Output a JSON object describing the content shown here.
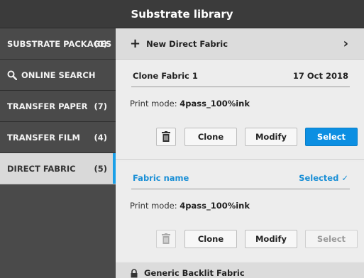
{
  "window": {
    "title": "Substrate library"
  },
  "sidebar": {
    "items": [
      {
        "label": "SUBSTRATE PACKAGES",
        "count": "(0)",
        "icon": ""
      },
      {
        "label": "ONLINE SEARCH",
        "count": "",
        "icon": "search-icon"
      },
      {
        "label": "TRANSFER PAPER",
        "count": "(7)",
        "icon": ""
      },
      {
        "label": "TRANSFER FILM",
        "count": "(4)",
        "icon": ""
      },
      {
        "label": "DIRECT FABRIC",
        "count": "(5)",
        "icon": "",
        "active": true
      }
    ]
  },
  "main": {
    "new_label": "New Direct Fabric",
    "cards": [
      {
        "name": "Clone Fabric 1",
        "date": "17 Oct 2018",
        "mode_label": "Print mode:",
        "mode_value": "4pass_100%ink",
        "clone": "Clone",
        "modify": "Modify",
        "select": "Select",
        "selected": false
      },
      {
        "name": "Fabric name",
        "date": "Selected",
        "mode_label": "Print mode:",
        "mode_value": "4pass_100%ink",
        "clone": "Clone",
        "modify": "Modify",
        "select": "Select",
        "selected": true
      }
    ],
    "next_label": "Generic Backlit Fabric"
  },
  "colors": {
    "accent": "#0c8fe2",
    "sidebar_bg": "#4a4a4a",
    "titlebar_bg": "#3b3b3b"
  }
}
